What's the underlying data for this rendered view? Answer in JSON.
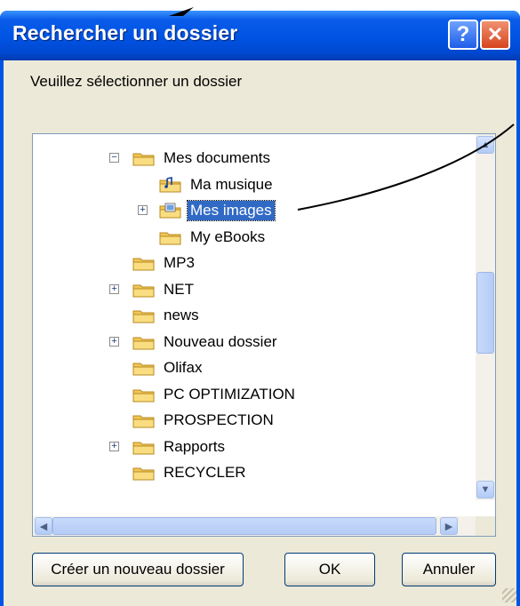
{
  "dialog": {
    "title": "Rechercher un dossier",
    "help_glyph": "?",
    "close_glyph": "✕",
    "prompt": "Veuillez sélectionner un dossier"
  },
  "tree": {
    "items": [
      {
        "label": "Mes documents",
        "expander": "−",
        "icon": "folder-icon",
        "level": 1,
        "selected": false
      },
      {
        "label": "Ma musique",
        "expander": "",
        "icon": "music-folder-icon",
        "level": 2,
        "selected": false
      },
      {
        "label": "Mes images",
        "expander": "+",
        "icon": "pictures-folder-icon",
        "level": 2,
        "selected": true
      },
      {
        "label": "My eBooks",
        "expander": "",
        "icon": "folder-icon",
        "level": 2,
        "selected": false
      },
      {
        "label": "MP3",
        "expander": "",
        "icon": "folder-icon",
        "level": 0,
        "selected": false
      },
      {
        "label": "NET",
        "expander": "+",
        "icon": "folder-icon",
        "level": 0,
        "selected": false
      },
      {
        "label": "news",
        "expander": "",
        "icon": "folder-icon",
        "level": 0,
        "selected": false
      },
      {
        "label": "Nouveau dossier",
        "expander": "+",
        "icon": "folder-icon",
        "level": 0,
        "selected": false
      },
      {
        "label": "Olifax",
        "expander": "",
        "icon": "folder-icon",
        "level": 0,
        "selected": false
      },
      {
        "label": "PC OPTIMIZATION",
        "expander": "",
        "icon": "folder-icon",
        "level": 0,
        "selected": false
      },
      {
        "label": "PROSPECTION",
        "expander": "",
        "icon": "folder-icon",
        "level": 0,
        "selected": false
      },
      {
        "label": "Rapports",
        "expander": "+",
        "icon": "folder-icon",
        "level": 0,
        "selected": false
      },
      {
        "label": "RECYCLER",
        "expander": "",
        "icon": "folder-icon",
        "level": 0,
        "selected": false
      }
    ]
  },
  "buttons": {
    "new_folder": "Créer un nouveau dossier",
    "ok": "OK",
    "cancel": "Annuler"
  },
  "colors": {
    "title_blue": "#0054e3",
    "selection": "#316ac5",
    "dialog_bg": "#ece9d8",
    "folder_yellow": "#f7d56b"
  }
}
